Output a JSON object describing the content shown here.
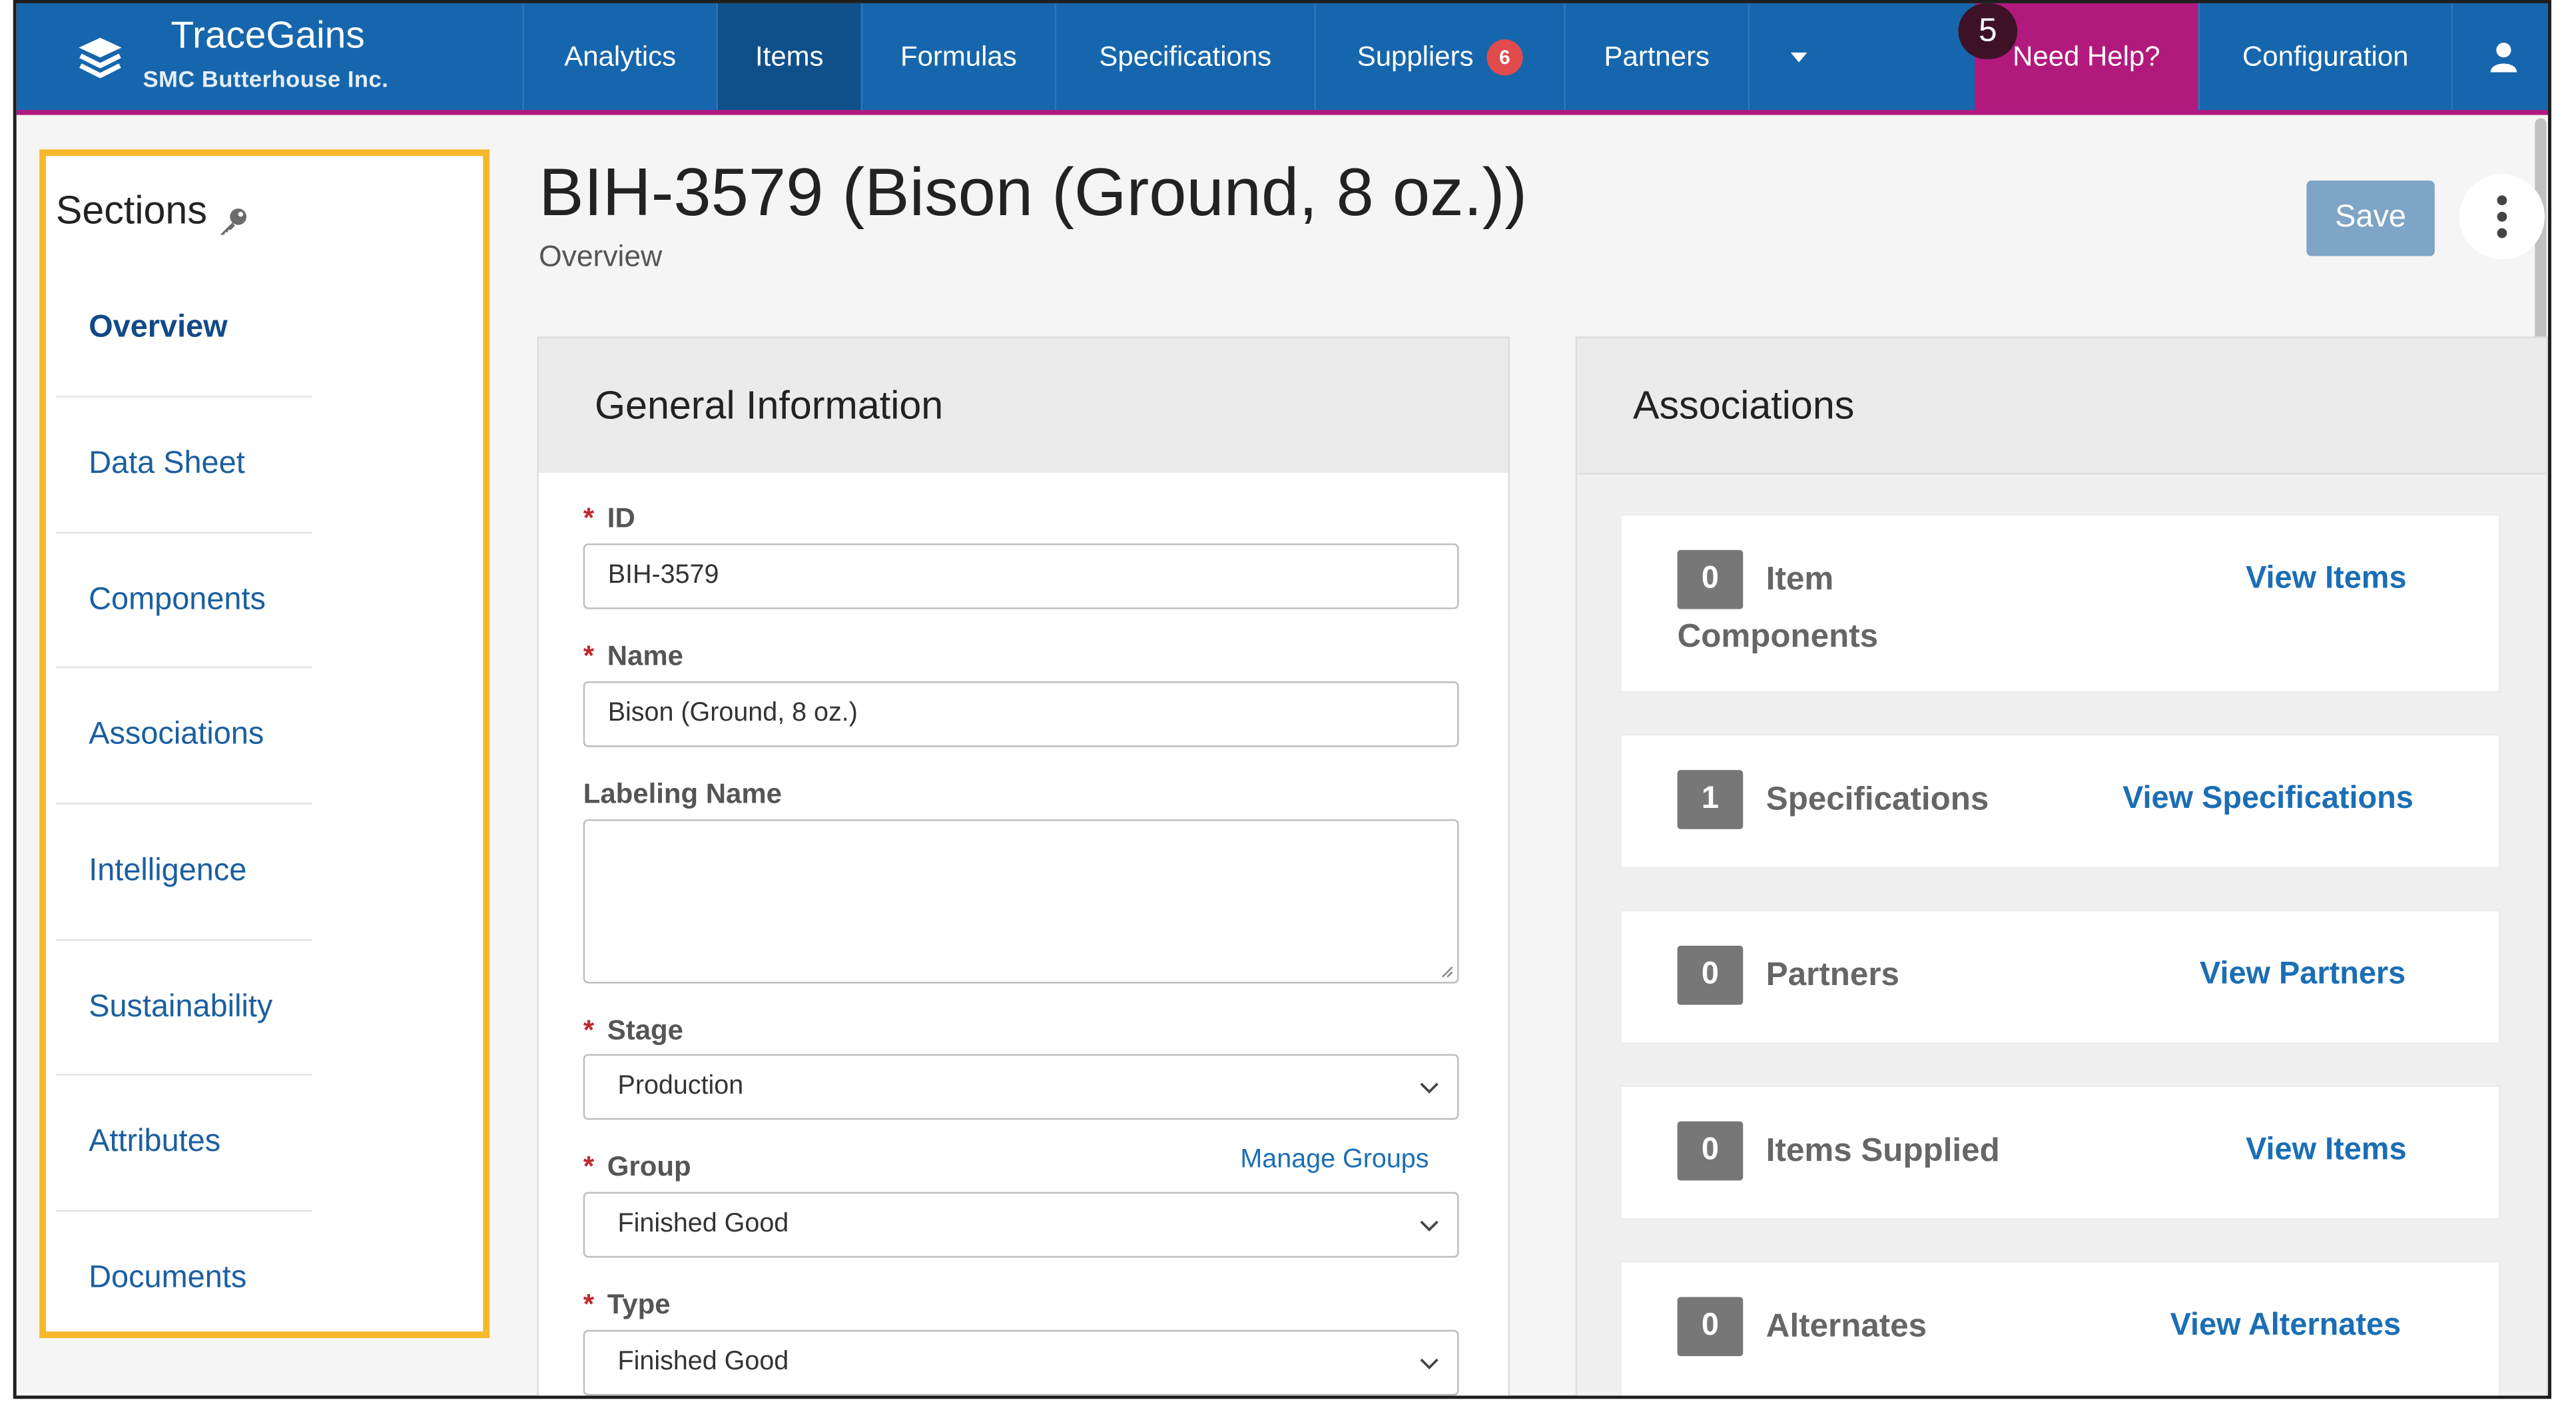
{
  "brand": {
    "name": "TraceGains",
    "company": "SMC Butterhouse Inc."
  },
  "nav": {
    "items": [
      {
        "label": "Analytics"
      },
      {
        "label": "Items"
      },
      {
        "label": "Formulas"
      },
      {
        "label": "Specifications"
      },
      {
        "label": "Suppliers",
        "badge": "6"
      },
      {
        "label": "Partners"
      }
    ],
    "help_count": "5",
    "help_label": "Need Help?",
    "configuration": "Configuration"
  },
  "sidebar": {
    "title": "Sections",
    "items": [
      {
        "label": "Overview"
      },
      {
        "label": "Data Sheet"
      },
      {
        "label": "Components"
      },
      {
        "label": "Associations"
      },
      {
        "label": "Intelligence"
      },
      {
        "label": "Sustainability"
      },
      {
        "label": "Attributes"
      },
      {
        "label": "Documents"
      }
    ]
  },
  "header": {
    "title": "BIH-3579 (Bison (Ground, 8 oz.))",
    "subtitle": "Overview",
    "save": "Save"
  },
  "general": {
    "title": "General Information",
    "id_label": "ID",
    "id_value": "BIH-3579",
    "name_label": "Name",
    "name_value": "Bison (Ground, 8 oz.)",
    "labeling_label": "Labeling Name",
    "labeling_value": "",
    "stage_label": "Stage",
    "stage_value": "Production",
    "group_label": "Group",
    "group_value": "Finished Good",
    "manage_groups": "Manage Groups",
    "type_label": "Type",
    "type_value": "Finished Good"
  },
  "associations": {
    "title": "Associations",
    "cards": [
      {
        "count": "0",
        "label_line1": "Item",
        "label_line2": "Components",
        "link": "View Items"
      },
      {
        "count": "1",
        "label": "Specifications",
        "link": "View Specifications"
      },
      {
        "count": "0",
        "label": "Partners",
        "link": "View Partners"
      },
      {
        "count": "0",
        "label": "Items Supplied",
        "link": "View Items"
      },
      {
        "count": "0",
        "label": "Alternates",
        "link": "View Alternates"
      }
    ]
  }
}
